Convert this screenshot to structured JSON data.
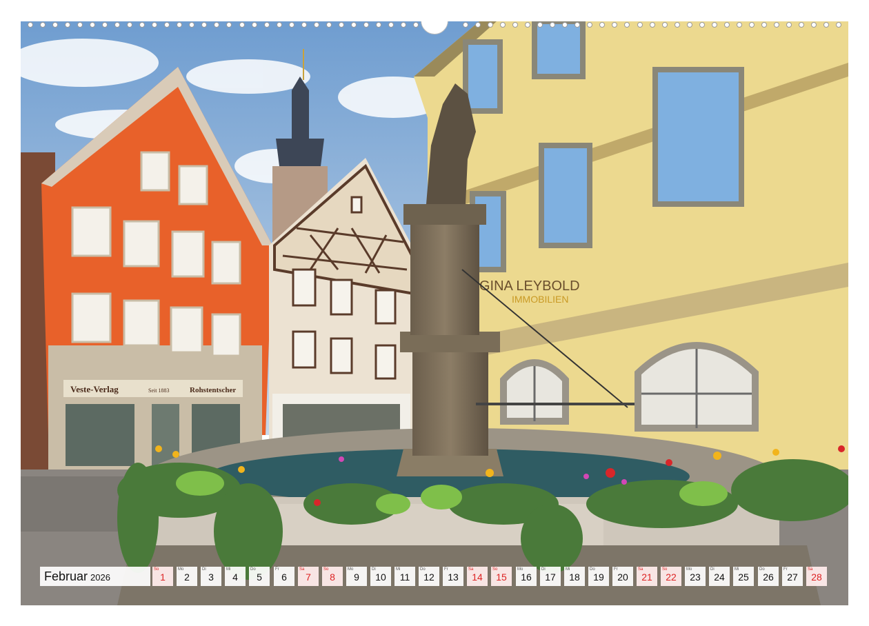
{
  "calendar": {
    "month": "Februar",
    "year": "2026",
    "days": [
      {
        "wd": "So",
        "n": "1",
        "we": true
      },
      {
        "wd": "Mo",
        "n": "2"
      },
      {
        "wd": "Di",
        "n": "3"
      },
      {
        "wd": "Mi",
        "n": "4"
      },
      {
        "wd": "Do",
        "n": "5"
      },
      {
        "wd": "Fr",
        "n": "6"
      },
      {
        "wd": "Sa",
        "n": "7",
        "we": true
      },
      {
        "wd": "So",
        "n": "8",
        "we": true
      },
      {
        "wd": "Mo",
        "n": "9"
      },
      {
        "wd": "Di",
        "n": "10"
      },
      {
        "wd": "Mi",
        "n": "11"
      },
      {
        "wd": "Do",
        "n": "12"
      },
      {
        "wd": "Fr",
        "n": "13"
      },
      {
        "wd": "Sa",
        "n": "14",
        "we": true
      },
      {
        "wd": "So",
        "n": "15",
        "we": true
      },
      {
        "wd": "Mo",
        "n": "16"
      },
      {
        "wd": "Di",
        "n": "17"
      },
      {
        "wd": "Mi",
        "n": "18"
      },
      {
        "wd": "Do",
        "n": "19"
      },
      {
        "wd": "Fr",
        "n": "20"
      },
      {
        "wd": "Sa",
        "n": "21",
        "we": true
      },
      {
        "wd": "So",
        "n": "22",
        "we": true
      },
      {
        "wd": "Mo",
        "n": "23"
      },
      {
        "wd": "Di",
        "n": "24"
      },
      {
        "wd": "Mi",
        "n": "25"
      },
      {
        "wd": "Do",
        "n": "26"
      },
      {
        "wd": "Fr",
        "n": "27"
      },
      {
        "wd": "Sa",
        "n": "28",
        "we": true
      }
    ]
  },
  "photo": {
    "shop_sign": "Veste-Verlag",
    "shop_sign_small": "Seit 1883",
    "shop_sign_right": "Rohstentscher",
    "building_sign_line1": "GINA LEYBOLD",
    "building_sign_line2": "IMMOBILIEN"
  },
  "colors": {
    "orange_house": "#e8612a",
    "yellow_house": "#ecd98f",
    "sky": "#8fb6dc",
    "weekend": "#dd2222"
  }
}
